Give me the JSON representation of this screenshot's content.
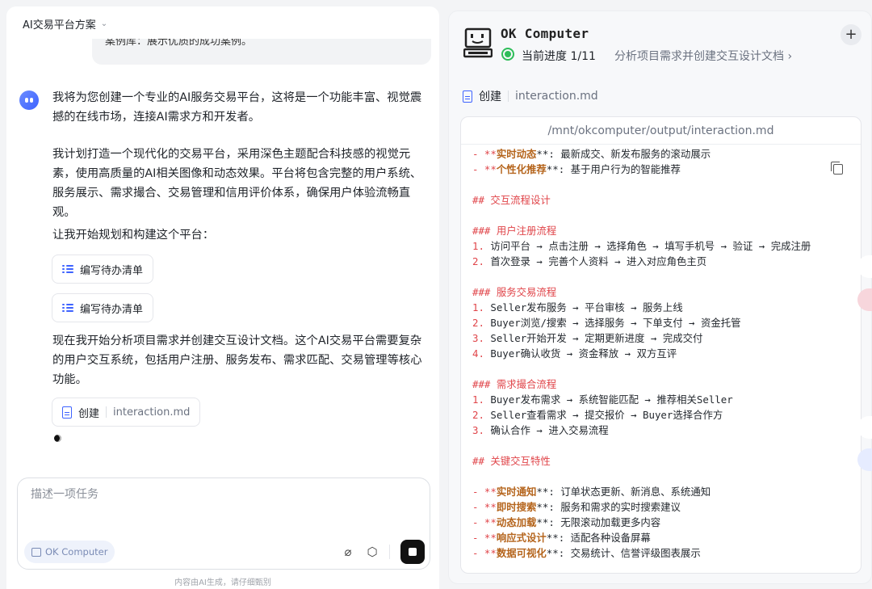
{
  "conversation": {
    "title": "AI交易平台方案"
  },
  "chat": {
    "prev_bubble_text": "案例库：展示优质的成功案例。",
    "para1": "我将为您创建一个专业的AI服务交易平台，这将是一个功能丰富、视觉震撼的在线市场，连接AI需求方和开发者。",
    "para2": "我计划打造一个现代化的交易平台，采用深色主题配合科技感的视觉元素，使用高质量的AI相关图像和动态效果。平台将包含完整的用户系统、服务展示、需求撮合、交易管理和信用评价体系，确保用户体验流畅直观。",
    "para3": "让我开始规划和构建这个平台：",
    "chip_todo1": "编写待办清单",
    "chip_todo2": "编写待办清单",
    "para4": "现在我开始分析项目需求并创建交互设计文档。这个AI交易平台需要复杂的用户交互系统，包括用户注册、服务发布、需求匹配、交易管理等核心功能。",
    "chip_create_action": "创建",
    "chip_create_file": "interaction.md"
  },
  "composer": {
    "placeholder": "描述一项任务",
    "mode_label": "OK Computer",
    "disclaimer": "内容由AI生成，请仔细甄别"
  },
  "panel": {
    "title": "OK Computer",
    "progress": "当前进度 1/11",
    "step": "分析项目需求并创建交互设计文档 ›",
    "file_action": "创建",
    "file_name": "interaction.md",
    "file_path": "/mnt/okcomputer/output/interaction.md"
  },
  "code": {
    "l1a": "- **",
    "l1b": "实时动态",
    "l1c": "**: 最新成交、新发布服务的滚动展示",
    "l2a": "- **",
    "l2b": "个性化推荐",
    "l2c": "**: 基于用户行为的智能推荐",
    "h_flow": "## 交互流程设计",
    "h_reg": "### 用户注册流程",
    "reg1": "访问平台 → 点击注册 → 选择角色 → 填写手机号 → 验证 → 完成注册",
    "reg2": "首次登录 → 完善个人资料 → 进入对应角色主页",
    "h_trade": "### 服务交易流程",
    "trade1": "Seller发布服务 → 平台审核 → 服务上线",
    "trade2": "Buyer浏览/搜索 → 选择服务 → 下单支付 → 资金托管",
    "trade3": "Seller开始开发 → 定期更新进度 → 完成交付",
    "trade4": "Buyer确认收货 → 资金释放 → 双方互评",
    "h_match": "### 需求撮合流程",
    "match1": "Buyer发布需求 → 系统智能匹配 → 推荐相关Seller",
    "match2": "Seller查看需求 → 提交报价 → Buyer选择合作方",
    "match3": "确认合作 → 进入交易流程",
    "h_key": "## 关键交互特性",
    "k1b": "实时通知",
    "k1c": "**: 订单状态更新、新消息、系统通知",
    "k2b": "即时搜索",
    "k2c": "**: 服务和需求的实时搜索建议",
    "k3b": "动态加载",
    "k3c": "**: 无限滚动加载更多内容",
    "k4b": "响应式设计",
    "k4c": "**: 适配各种设备屏幕",
    "k5b": "数据可视化",
    "k5c": "**: 交易统计、信誉评级图表展示",
    "n1": "1. ",
    "n2": "2. ",
    "n3": "3. ",
    "n4": "4. "
  }
}
